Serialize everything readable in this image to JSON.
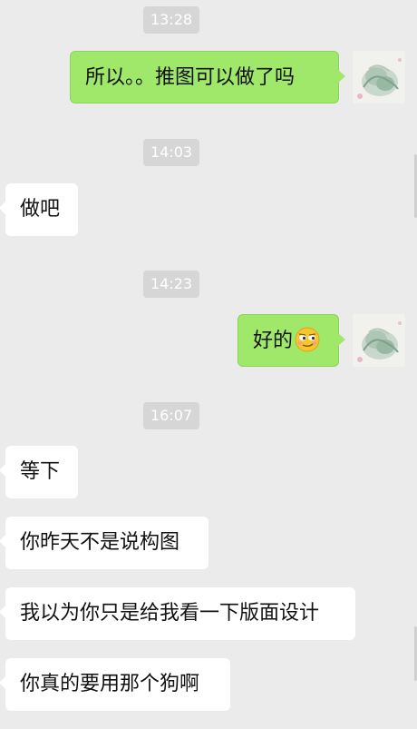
{
  "messages": [
    {
      "time": "13:28"
    },
    {
      "side": "out",
      "text": "所以。。推图可以做了吗"
    },
    {
      "time": "14:03"
    },
    {
      "side": "in",
      "text": "做吧"
    },
    {
      "time": "14:23"
    },
    {
      "side": "out",
      "text": "好的",
      "emoji": "smirk-face-icon"
    },
    {
      "time": "16:07"
    },
    {
      "side": "in",
      "text": "等下"
    },
    {
      "side": "in",
      "text": "你昨天不是说构图"
    },
    {
      "side": "in",
      "text": "我以为你只是给我看一下版面设计"
    },
    {
      "side": "in",
      "text": "你真的要用那个狗啊"
    }
  ],
  "colors": {
    "background": "#ebebeb",
    "outgoing_bubble": "#9fe86a",
    "incoming_bubble": "#ffffff",
    "timestamp_bg": "#d6d6d6"
  }
}
